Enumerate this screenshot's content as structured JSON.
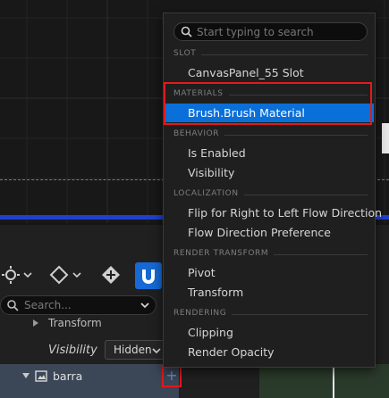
{
  "menu": {
    "search_placeholder": "Start typing to search",
    "sections": [
      {
        "header": "SLOT",
        "items": [
          "CanvasPanel_55 Slot"
        ]
      },
      {
        "header": "MATERIALS",
        "items": [
          "Brush.Brush Material"
        ]
      },
      {
        "header": "BEHAVIOR",
        "items": [
          "Is Enabled",
          "Visibility"
        ]
      },
      {
        "header": "LOCALIZATION",
        "items": [
          "Flip for Right to Left Flow Direction",
          "Flow Direction Preference"
        ]
      },
      {
        "header": "RENDER TRANSFORM",
        "items": [
          "Pivot",
          "Transform"
        ]
      },
      {
        "header": "RENDERING",
        "items": [
          "Clipping",
          "Render Opacity"
        ]
      }
    ],
    "selected_item": "Brush.Brush Material"
  },
  "panel": {
    "search_placeholder": "Search...",
    "transform_label": "Transform",
    "visibility_label": "Visibility",
    "visibility_value": "Hidden",
    "widget_name": "barra",
    "add_symbol": "+"
  },
  "colors": {
    "accent": "#0a6fd8",
    "highlight": "#e01b1b",
    "viewport_line": "#1f3fd0"
  }
}
